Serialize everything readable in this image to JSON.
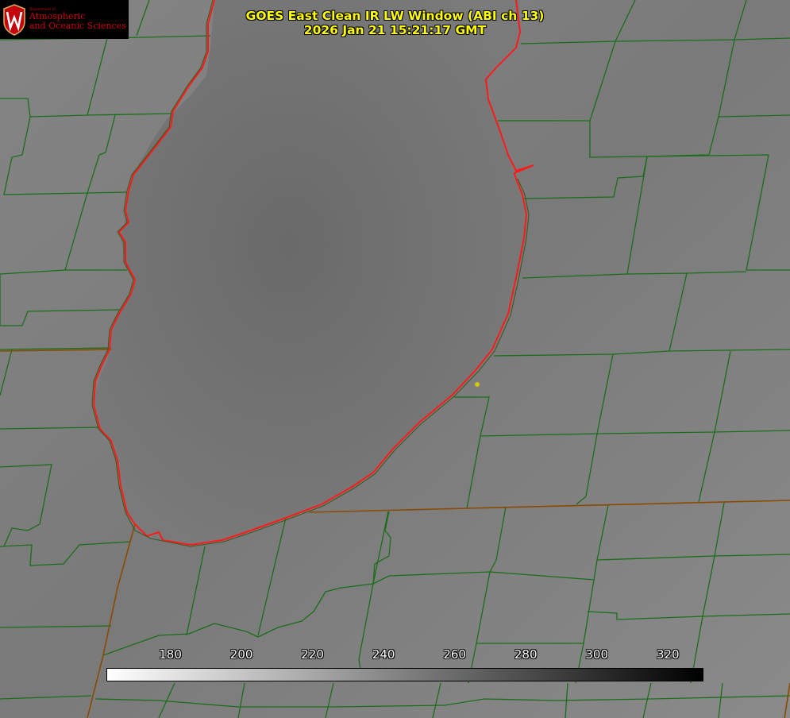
{
  "logo": {
    "department": "Department of",
    "line1": "Atmospheric",
    "line2": "and Oceanic Sciences",
    "seal_letter": "W"
  },
  "title": {
    "line1": "GOES East Clean IR LW Window (ABI ch 13)",
    "line2": "2026 Jan 21 15:21:17 GMT"
  },
  "colorbar": {
    "ticks": [
      180,
      200,
      220,
      240,
      260,
      280,
      300,
      320
    ],
    "range": [
      162,
      330
    ],
    "colors": {
      "low": "#ffffff",
      "high": "#000000"
    }
  },
  "colors": {
    "background_gray": "#7d7d7d",
    "county_lines": "#1a6e1a",
    "state_lines": "#8a4a00",
    "coastline": "#ff0000",
    "title_text": "#ffff00",
    "logo_text": "#c5050c",
    "point_marker": "#d4c800"
  }
}
